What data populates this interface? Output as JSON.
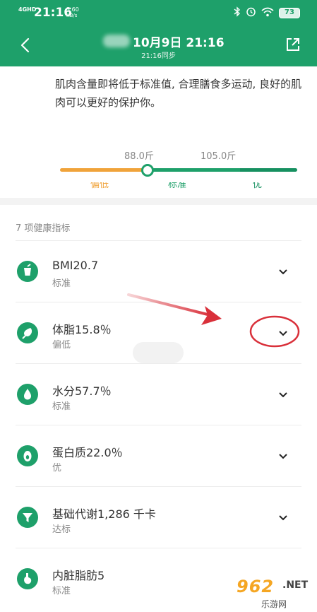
{
  "status_bar": {
    "network": "4GHD",
    "time": "21:16",
    "speed_value": "3.60",
    "speed_unit": "KB/s",
    "battery": "73"
  },
  "header": {
    "title": "10月9日 21:16",
    "subtitle": "21:16同步"
  },
  "advice": "肌肉含量即将低于标准值, 合理膳食多运动, 良好的肌肉可以更好的保护你。",
  "gauge": {
    "low_threshold": "88.0斤",
    "high_threshold": "105.0斤",
    "labels": [
      "偏低",
      "标准",
      "优"
    ],
    "colors": {
      "low": "#f0a33a",
      "standard": "#1ea06a",
      "high": "#169060"
    },
    "marker_position": 0.37
  },
  "list": {
    "title": "7 项健康指标",
    "items": [
      {
        "name": "BMI20.7",
        "status": "标准",
        "icon": "bmi-cup-icon"
      },
      {
        "name": "体脂15.8％",
        "status": "偏低",
        "icon": "body-fat-icon"
      },
      {
        "name": "水分57.7％",
        "status": "标准",
        "icon": "water-drop-icon"
      },
      {
        "name": "蛋白质22.0％",
        "status": "优",
        "icon": "protein-icon"
      },
      {
        "name": "基础代谢1,286 千卡",
        "status": "达标",
        "icon": "metabolism-funnel-icon"
      },
      {
        "name": "内脏脂肪5",
        "status": "标准",
        "icon": "visceral-fat-stomach-icon"
      }
    ]
  },
  "watermark": {
    "main": "962",
    "suffix": ".NET",
    "sub": "乐游网"
  },
  "accent_color": "#1ea06a",
  "annotation_color": "#d9303a"
}
